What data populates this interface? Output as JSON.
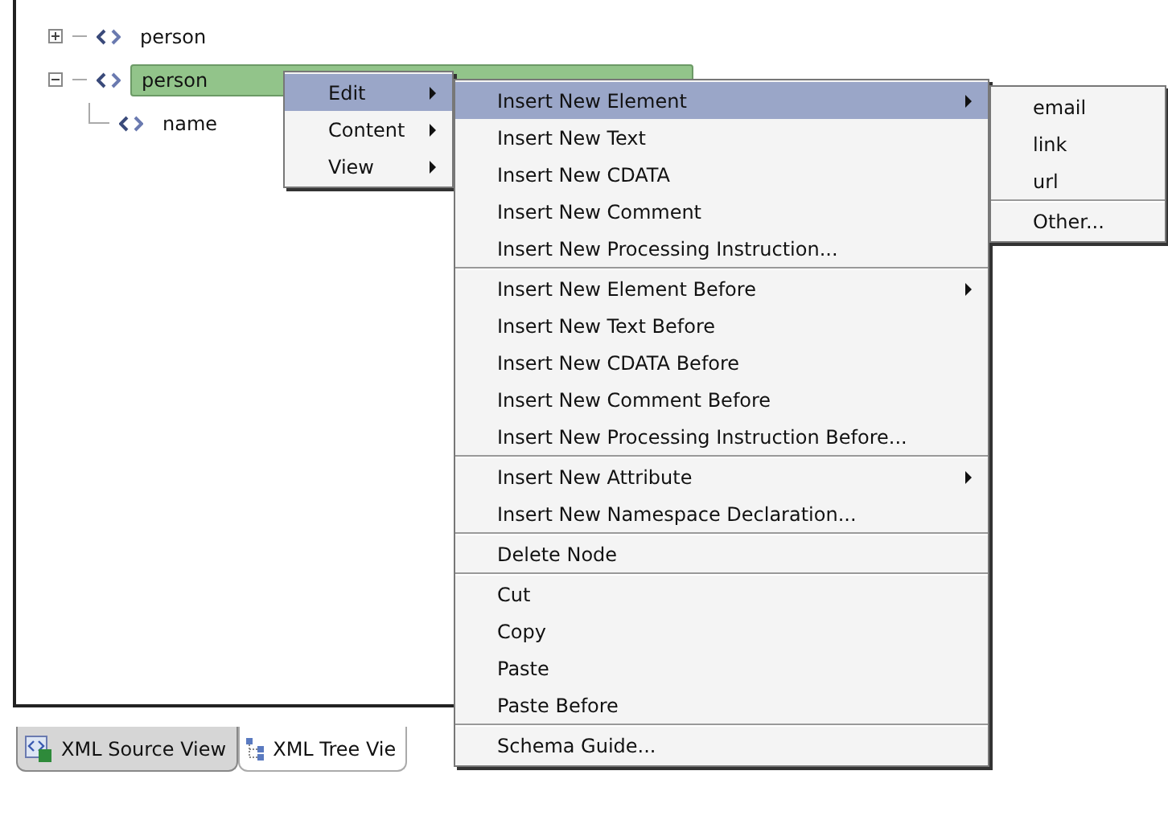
{
  "tree": [
    {
      "label": "person",
      "expanded": false,
      "selected": false
    },
    {
      "label": "person",
      "expanded": true,
      "selected": true,
      "children": [
        {
          "label": "name",
          "selected": false
        }
      ]
    }
  ],
  "context_menu": {
    "groups": [
      [
        {
          "label": "Edit",
          "submenu": true,
          "selected": true
        },
        {
          "label": "Content",
          "submenu": true,
          "selected": false
        },
        {
          "label": "View",
          "submenu": true,
          "selected": false
        }
      ]
    ]
  },
  "edit_submenu": {
    "groups": [
      [
        {
          "label": "Insert New Element",
          "submenu": true,
          "selected": true
        },
        {
          "label": "Insert New Text",
          "submenu": false,
          "selected": false
        },
        {
          "label": "Insert New CDATA",
          "submenu": false,
          "selected": false
        },
        {
          "label": "Insert New Comment",
          "submenu": false,
          "selected": false
        },
        {
          "label": "Insert New Processing Instruction...",
          "submenu": false,
          "selected": false
        }
      ],
      [
        {
          "label": "Insert New Element Before",
          "submenu": true,
          "selected": false
        },
        {
          "label": "Insert New Text Before",
          "submenu": false,
          "selected": false
        },
        {
          "label": "Insert New CDATA Before",
          "submenu": false,
          "selected": false
        },
        {
          "label": "Insert New Comment Before",
          "submenu": false,
          "selected": false
        },
        {
          "label": "Insert New Processing Instruction Before...",
          "submenu": false,
          "selected": false
        }
      ],
      [
        {
          "label": "Insert New Attribute",
          "submenu": true,
          "selected": false
        },
        {
          "label": "Insert New Namespace Declaration...",
          "submenu": false,
          "selected": false
        }
      ],
      [
        {
          "label": "Delete Node",
          "submenu": false,
          "selected": false
        }
      ],
      [
        {
          "label": "Cut",
          "submenu": false,
          "selected": false
        },
        {
          "label": "Copy",
          "submenu": false,
          "selected": false
        },
        {
          "label": "Paste",
          "submenu": false,
          "selected": false
        },
        {
          "label": "Paste Before",
          "submenu": false,
          "selected": false
        }
      ],
      [
        {
          "label": "Schema Guide...",
          "submenu": false,
          "selected": false
        }
      ]
    ]
  },
  "element_submenu": {
    "groups": [
      [
        {
          "label": "email",
          "submenu": false,
          "selected": false
        },
        {
          "label": "link",
          "submenu": false,
          "selected": false
        },
        {
          "label": "url",
          "submenu": false,
          "selected": false
        }
      ],
      [
        {
          "label": "Other...",
          "submenu": false,
          "selected": false
        }
      ]
    ]
  },
  "tabs": [
    {
      "label": "XML Source View",
      "kind": "source",
      "selected": true
    },
    {
      "label": "XML Tree Vie",
      "kind": "tree",
      "selected": false
    }
  ]
}
